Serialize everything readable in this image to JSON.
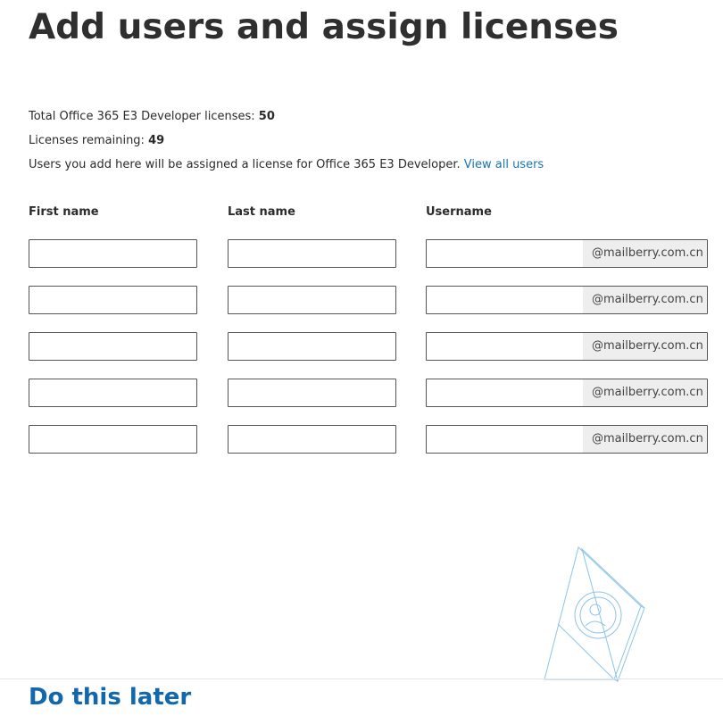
{
  "page": {
    "title": "Add users and assign licenses"
  },
  "licenses": {
    "total_label": "Total Office 365 E3 Developer licenses: ",
    "total_value": "50",
    "remaining_label": "Licenses remaining: ",
    "remaining_value": "49",
    "assign_note": "Users you add here will be assigned a license for Office 365 E3 Developer. ",
    "view_all_link": "View all users"
  },
  "form": {
    "columns": {
      "first_name": "First name",
      "last_name": "Last name",
      "username": "Username"
    },
    "domain_suffix": "@mailberry.com.cn",
    "rows": [
      {
        "first_name": "",
        "last_name": "",
        "username": ""
      },
      {
        "first_name": "",
        "last_name": "",
        "username": ""
      },
      {
        "first_name": "",
        "last_name": "",
        "username": ""
      },
      {
        "first_name": "",
        "last_name": "",
        "username": ""
      },
      {
        "first_name": "",
        "last_name": "",
        "username": ""
      }
    ]
  },
  "footer": {
    "do_later_link": "Do this later"
  },
  "colors": {
    "link": "#1a73b5",
    "do_later": "#1268ad",
    "title": "#2f2f2f",
    "field_border": "#555555",
    "suffix_bg": "#eeeeee",
    "illustration_line": "#8cc4e8"
  },
  "icons": {
    "illustration": "user-card-illustration"
  }
}
